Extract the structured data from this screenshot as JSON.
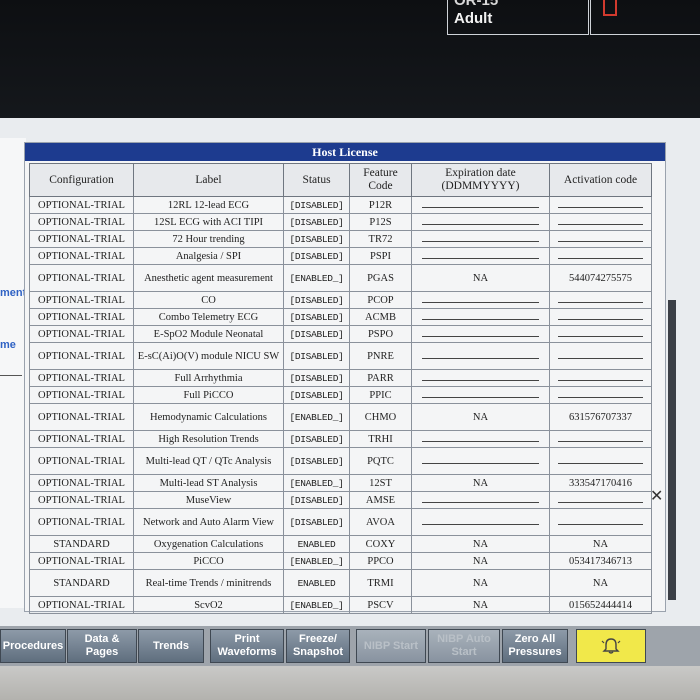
{
  "patient": {
    "line1": "OR-15",
    "category": "Adult"
  },
  "side_labels": [
    "ment",
    "me"
  ],
  "panel": {
    "title": "Host License"
  },
  "columns": [
    "Configuration",
    "Label",
    "Status",
    "Feature Code",
    "Expiration date (DDMMYYYY)",
    "Activation code"
  ],
  "rows": [
    {
      "config": "OPTIONAL-TRIAL",
      "label": "12RL 12-lead ECG",
      "status": "[DISABLED]",
      "code": "P12R",
      "expiration": "",
      "activation": ""
    },
    {
      "config": "OPTIONAL-TRIAL",
      "label": "12SL ECG with ACI TIPI",
      "status": "[DISABLED]",
      "code": "P12S",
      "expiration": "",
      "activation": ""
    },
    {
      "config": "OPTIONAL-TRIAL",
      "label": "72 Hour trending",
      "status": "[DISABLED]",
      "code": "TR72",
      "expiration": "",
      "activation": ""
    },
    {
      "config": "OPTIONAL-TRIAL",
      "label": "Analgesia / SPI",
      "status": "[DISABLED]",
      "code": "PSPI",
      "expiration": "",
      "activation": ""
    },
    {
      "config": "OPTIONAL-TRIAL",
      "label": "Anesthetic agent measurement",
      "status": "[ENABLED_]",
      "code": "PGAS",
      "expiration": "NA",
      "activation": "544074275575"
    },
    {
      "config": "OPTIONAL-TRIAL",
      "label": "CO",
      "status": "[DISABLED]",
      "code": "PCOP",
      "expiration": "",
      "activation": ""
    },
    {
      "config": "OPTIONAL-TRIAL",
      "label": "Combo Telemetry ECG",
      "status": "[DISABLED]",
      "code": "ACMB",
      "expiration": "",
      "activation": ""
    },
    {
      "config": "OPTIONAL-TRIAL",
      "label": "E-SpO2 Module Neonatal",
      "status": "[DISABLED]",
      "code": "PSPO",
      "expiration": "",
      "activation": ""
    },
    {
      "config": "OPTIONAL-TRIAL",
      "label": "E-sC(Ai)O(V) module NICU SW",
      "status": "[DISABLED]",
      "code": "PNRE",
      "expiration": "",
      "activation": ""
    },
    {
      "config": "OPTIONAL-TRIAL",
      "label": "Full Arrhythmia",
      "status": "[DISABLED]",
      "code": "PARR",
      "expiration": "",
      "activation": ""
    },
    {
      "config": "OPTIONAL-TRIAL",
      "label": "Full PiCCO",
      "status": "[DISABLED]",
      "code": "PPIC",
      "expiration": "",
      "activation": ""
    },
    {
      "config": "OPTIONAL-TRIAL",
      "label": "Hemodynamic Calculations",
      "status": "[ENABLED_]",
      "code": "CHMO",
      "expiration": "NA",
      "activation": "631576707337"
    },
    {
      "config": "OPTIONAL-TRIAL",
      "label": "High Resolution Trends",
      "status": "[DISABLED]",
      "code": "TRHI",
      "expiration": "",
      "activation": ""
    },
    {
      "config": "OPTIONAL-TRIAL",
      "label": "Multi-lead QT / QTc Analysis",
      "status": "[DISABLED]",
      "code": "PQTC",
      "expiration": "",
      "activation": ""
    },
    {
      "config": "OPTIONAL-TRIAL",
      "label": "Multi-lead ST Analysis",
      "status": "[ENABLED_]",
      "code": "12ST",
      "expiration": "NA",
      "activation": "333547170416"
    },
    {
      "config": "OPTIONAL-TRIAL",
      "label": "MuseView",
      "status": "[DISABLED]",
      "code": "AMSE",
      "expiration": "",
      "activation": ""
    },
    {
      "config": "OPTIONAL-TRIAL",
      "label": "Network and Auto Alarm View",
      "status": "[DISABLED]",
      "code": "AVOA",
      "expiration": "",
      "activation": ""
    },
    {
      "config": "STANDARD",
      "label": "Oxygenation Calculations",
      "status": "ENABLED",
      "code": "COXY",
      "expiration": "NA",
      "activation": "NA"
    },
    {
      "config": "OPTIONAL-TRIAL",
      "label": "PiCCO",
      "status": "[ENABLED_]",
      "code": "PPCO",
      "expiration": "NA",
      "activation": "053417346713"
    },
    {
      "config": "STANDARD",
      "label": "Real-time Trends / minitrends",
      "status": "ENABLED",
      "code": "TRMI",
      "expiration": "NA",
      "activation": "NA"
    },
    {
      "config": "OPTIONAL-TRIAL",
      "label": "ScvO2",
      "status": "[ENABLED_]",
      "code": "PSCV",
      "expiration": "NA",
      "activation": "015652444414"
    }
  ],
  "toolbar": {
    "procedures": "Procedures",
    "data_pages": "Data & Pages",
    "trends": "Trends",
    "print_waveforms": "Print Waveforms",
    "freeze_snapshot": "Freeze/ Snapshot",
    "nibp_start": "NIBP Start",
    "nibp_auto_start": "NIBP Auto Start",
    "zero_all_pressures": "Zero All Pressures",
    "alarm_icon": "bell-alarm-icon"
  }
}
